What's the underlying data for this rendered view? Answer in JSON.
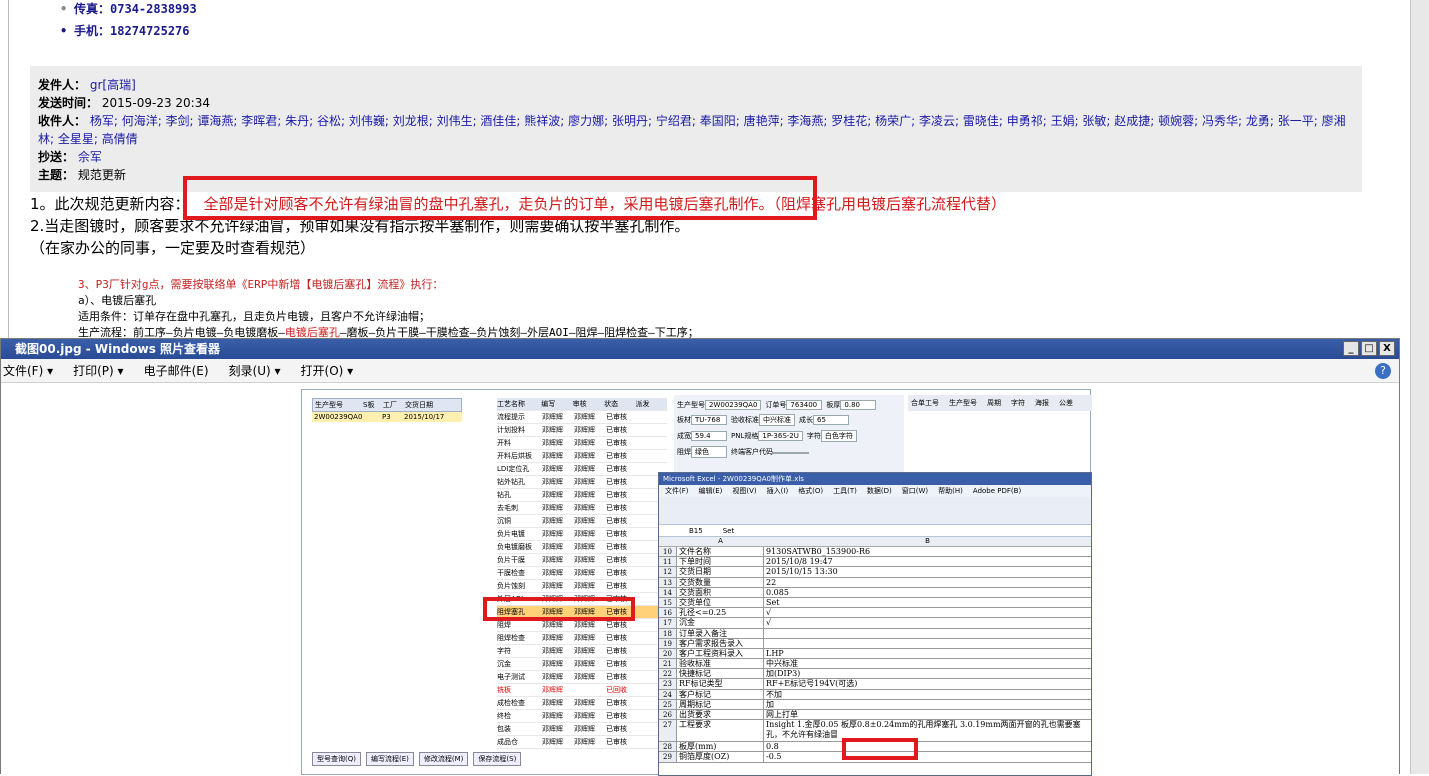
{
  "contacts": [
    {
      "label": "传真：",
      "value": "0734-2838993"
    },
    {
      "label": "手机：",
      "value": "18274725276"
    }
  ],
  "header": {
    "from_label": "发件人：",
    "from_value": "gr[高瑞]",
    "sent_label": "发送时间：",
    "sent_value": "2015-09-23 20:34",
    "to_label": "收件人：",
    "to_value": "杨军; 何海洋; 李剑; 谭海燕; 李晖君; 朱丹; 谷松; 刘伟巍; 刘龙根; 刘伟生; 酒佳佳; 熊祥波; 廖力娜; 张明丹; 宁绍君; 奉国阳; 唐艳萍; 李海燕; 罗桂花; 杨荣广; 李凌云; 雷晓佳; 申勇祁; 王娟; 张敏; 赵成捷; 顿婉蓉; 冯秀华; 龙勇; 张一平; 廖湘林; 全星星; 高倩倩",
    "cc_label": "抄送：",
    "cc_value": "佘军",
    "subject_label": "主题：",
    "subject_value": "规范更新"
  },
  "body": {
    "line1_prefix": "1。此次规范更新内容：",
    "line1_red": "全部是针对顾客不允许有绿油冒的盘中孔塞孔，走负片的订单，采用电镀后塞孔制作。（阻焊塞孔用电镀后塞孔流程代替）",
    "line2": "2.当走图镀时，顾客要求不允许绿油冒，预审如果没有指示按半塞制作，则需要确认按半塞孔制作。",
    "line3": "（在家办公的同事，一定要及时查看规范）",
    "code1": "3、P3厂针对g点，需要按联络单《ERP中新增【电镀后塞孔】流程》执行：",
    "code2": "a）、电镀后塞孔",
    "code3": "    适用条件：订单存在盘中孔塞孔，且走负片电镀，且客户不允许绿油帽；",
    "code4_a": "    生产流程：前工序—负片电镀—负电镀磨板—",
    "code4_red": "电镀后塞孔",
    "code4_b": "—磨板—负片干膜—干膜检查—负片蚀刻—外层AOI—阻焊—阻焊检查—下工序；"
  },
  "viewer": {
    "title": "截图00.jpg - Windows 照片查看器",
    "menu": [
      "文件(F) ▾",
      "打印(P) ▾",
      "电子邮件(E)",
      "刻录(U) ▾",
      "打开(O) ▾"
    ],
    "help": "?",
    "win_buttons": [
      "_",
      "□",
      "X"
    ]
  },
  "erp": {
    "left_headers": [
      "生产型号",
      "S板",
      "工厂",
      "交货日期"
    ],
    "left_row": [
      "2W00239QA0",
      "",
      "P3",
      "2015/10/17"
    ],
    "mid_headers": [
      "工艺名称",
      "编写",
      "审核",
      "状态",
      "派发"
    ],
    "mid_rows": [
      [
        "流程提示",
        "邓辉辉",
        "邓辉辉",
        "已审核"
      ],
      [
        "计划投料",
        "邓辉辉",
        "邓辉辉",
        "已审核"
      ],
      [
        "开料",
        "邓辉辉",
        "邓辉辉",
        "已审核"
      ],
      [
        "开料后烘板",
        "邓辉辉",
        "邓辉辉",
        "已审核"
      ],
      [
        "LDI定位孔",
        "邓辉辉",
        "邓辉辉",
        "已审核"
      ],
      [
        "钻外钻孔",
        "邓辉辉",
        "邓辉辉",
        "已审核"
      ],
      [
        "钻孔",
        "邓辉辉",
        "邓辉辉",
        "已审核"
      ],
      [
        "去毛刺",
        "邓辉辉",
        "邓辉辉",
        "已审核"
      ],
      [
        "沉铜",
        "邓辉辉",
        "邓辉辉",
        "已审核"
      ],
      [
        "负片电镀",
        "邓辉辉",
        "邓辉辉",
        "已审核"
      ],
      [
        "负电镀磨板",
        "邓辉辉",
        "邓辉辉",
        "已审核"
      ],
      [
        "负片干膜",
        "邓辉辉",
        "邓辉辉",
        "已审核"
      ],
      [
        "干膜检查",
        "邓辉辉",
        "邓辉辉",
        "已审核"
      ],
      [
        "负片蚀刻",
        "邓辉辉",
        "邓辉辉",
        "已审核"
      ],
      [
        "外层AOI",
        "邓辉辉",
        "邓辉辉",
        "已审核"
      ],
      [
        "阻焊塞孔",
        "邓辉辉",
        "邓辉辉",
        "已审核"
      ],
      [
        "阻焊",
        "邓辉辉",
        "邓辉辉",
        "已审核"
      ],
      [
        "阻焊检查",
        "邓辉辉",
        "邓辉辉",
        "已审核"
      ],
      [
        "字符",
        "邓辉辉",
        "邓辉辉",
        "已审核"
      ],
      [
        "沉金",
        "邓辉辉",
        "邓辉辉",
        "已审核"
      ],
      [
        "电子测试",
        "邓辉辉",
        "邓辉辉",
        "已审核"
      ],
      [
        "铣板",
        "邓辉辉",
        "",
        "已回收"
      ],
      [
        "成检检查",
        "邓辉辉",
        "邓辉辉",
        "已审核"
      ],
      [
        "终检",
        "邓辉辉",
        "邓辉辉",
        "已审核"
      ],
      [
        "包装",
        "邓辉辉",
        "邓辉辉",
        "已审核"
      ],
      [
        "成品仓",
        "邓辉辉",
        "邓辉辉",
        "已审核"
      ]
    ],
    "fields": [
      {
        "k": "生产型号",
        "v": "2W00239QA0"
      },
      {
        "k": "订单号",
        "v": "763400"
      },
      {
        "k": "板厚",
        "v": "0.80"
      },
      {
        "k": "板材",
        "v": "TU-768"
      },
      {
        "k": "验收标准",
        "v": "中兴标准"
      },
      {
        "k": "成长",
        "v": "65"
      },
      {
        "k": "成宽",
        "v": "59.4"
      },
      {
        "k": "PNL规格",
        "v": "1P-36S-2U"
      },
      {
        "k": "字符",
        "v": "白色字符"
      },
      {
        "k": "阻焊",
        "v": "绿色"
      },
      {
        "k": "终端客户代码",
        "v": ""
      }
    ],
    "right_headers": [
      "合单工号",
      "生产型号",
      "周期",
      "字符",
      "海报",
      "公差"
    ],
    "buttons": [
      "型号查询(Q)",
      "编写流程(E)",
      "修改流程(M)",
      "保存流程(S)"
    ]
  },
  "excel": {
    "title": "Microsoft Excel - 2W00239QA0制作单.xls",
    "menu": [
      "文件(F)",
      "编辑(E)",
      "视图(V)",
      "插入(I)",
      "格式(O)",
      "工具(T)",
      "数据(D)",
      "窗口(W)",
      "帮助(H)",
      "Adobe PDF(B)"
    ],
    "cell_ref": "B15",
    "formula": "Set",
    "col_a": "A",
    "col_b": "B",
    "rows": [
      {
        "n": "10",
        "a": "文件名称",
        "b": "9130SATWB0_153900-R6"
      },
      {
        "n": "11",
        "a": "下单时间",
        "b": "2015/10/8 19:47"
      },
      {
        "n": "12",
        "a": "交货日期",
        "b": "2015/10/15 13:30"
      },
      {
        "n": "13",
        "a": "交货数量",
        "b": "22"
      },
      {
        "n": "14",
        "a": "交货面积",
        "b": "0.085"
      },
      {
        "n": "15",
        "a": "交货单位",
        "b": "Set"
      },
      {
        "n": "16",
        "a": "孔径<=0.25",
        "b": "√"
      },
      {
        "n": "17",
        "a": "沉金",
        "b": "√"
      },
      {
        "n": "18",
        "a": "订单录入备注",
        "b": ""
      },
      {
        "n": "19",
        "a": "客户需求报告录入",
        "b": ""
      },
      {
        "n": "20",
        "a": "客户工程资料录入",
        "b": "LHP"
      },
      {
        "n": "21",
        "a": "验收标准",
        "b": "中兴标准"
      },
      {
        "n": "22",
        "a": "快捷标记",
        "b": "加(DIP3)"
      },
      {
        "n": "23",
        "a": "RF标记类型",
        "b": "RF+E标记号194V(可选)"
      },
      {
        "n": "24",
        "a": "客户标记",
        "b": "不加"
      },
      {
        "n": "25",
        "a": "周期标记",
        "b": "加"
      },
      {
        "n": "26",
        "a": "出货要求",
        "b": "网上打单"
      },
      {
        "n": "27",
        "a": "工程要求",
        "b": "Insight  1.金厚0.05   板厚0.8±0.24mm的孔用焊塞孔  3.0.19mm两面开窗的孔也需要塞孔，不允许有绿油冒"
      },
      {
        "n": "28",
        "a": "板厚(mm)",
        "b": "0.8"
      },
      {
        "n": "29",
        "a": "铜箔厚度(OZ)",
        "b": "-0.5"
      }
    ]
  }
}
